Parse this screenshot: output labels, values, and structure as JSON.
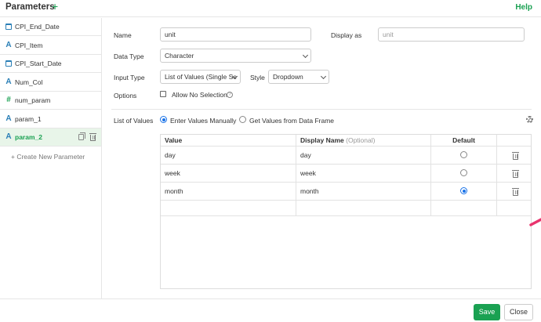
{
  "header": {
    "title": "Parameters",
    "help": "Help"
  },
  "sidebar": {
    "items": [
      {
        "label": "CPI_End_Date",
        "icon": "calendar-icon"
      },
      {
        "label": "CPI_Item",
        "icon": "character-type-icon"
      },
      {
        "label": "CPI_Start_Date",
        "icon": "calendar-icon"
      },
      {
        "label": "Num_Col",
        "icon": "character-type-icon"
      },
      {
        "label": "num_param",
        "icon": "number-type-icon"
      },
      {
        "label": "param_1",
        "icon": "character-type-icon"
      },
      {
        "label": "param_2",
        "icon": "character-type-icon",
        "selected": true
      }
    ],
    "create_label": "+ Create New Parameter"
  },
  "form": {
    "name_label": "Name",
    "name_value": "unit",
    "display_as_label": "Display as",
    "display_as_placeholder": "unit",
    "data_type_label": "Data Type",
    "data_type_value": "Character",
    "input_type_label": "Input Type",
    "input_type_value": "List of Values (Single Se",
    "style_label": "Style",
    "style_value": "Dropdown",
    "options_label": "Options",
    "allow_no_selection": "Allow No Selection",
    "help_glyph": "?",
    "list_of_values_label": "List of Values",
    "enter_manually": "Enter Values Manually",
    "get_from_df": "Get Values from Data Frame"
  },
  "values_table": {
    "headers": {
      "value": "Value",
      "display_name": "Display Name",
      "optional": "(Optional)",
      "default": "Default"
    },
    "rows": [
      {
        "value": "day",
        "display_name": "day",
        "default": false
      },
      {
        "value": "week",
        "display_name": "week",
        "default": false
      },
      {
        "value": "month",
        "display_name": "month",
        "default": true
      }
    ]
  },
  "footer": {
    "save": "Save",
    "close": "Close"
  },
  "colors": {
    "accent_green": "#1aa152",
    "radio_blue": "#1a73e8",
    "arrow_pink": "#e8336d",
    "type_icon_blue": "#2a7fb6"
  }
}
